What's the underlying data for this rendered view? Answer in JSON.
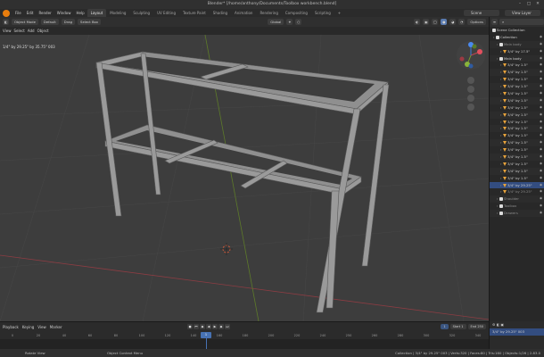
{
  "window": {
    "title": "Blender* [/home/anthony/Documents/Toolbox workbench.blend]"
  },
  "menu": {
    "items": [
      "File",
      "Edit",
      "Render",
      "Window",
      "Help"
    ]
  },
  "workspaces": [
    "Layout",
    "Modeling",
    "Sculpting",
    "UV Editing",
    "Texture Paint",
    "Shading",
    "Animation",
    "Rendering",
    "Compositing",
    "Scripting",
    "+"
  ],
  "scene": {
    "label": "Scene",
    "view_layer": "View Layer"
  },
  "viewport_header": {
    "mode": "Object Mode",
    "orientation": "Default",
    "drag": "Drag",
    "select": "Select Box",
    "view": "View",
    "select_menu": "Select",
    "add": "Add",
    "object": "Object",
    "transform": "Global",
    "options": "Options"
  },
  "viewport": {
    "info_line": "1/4\" by 29.25\" by 35.75\" 003"
  },
  "outliner": {
    "title": "Scene Collection",
    "rows": [
      {
        "label": "Collection",
        "kind": "collection",
        "indent": 1,
        "dim": false,
        "sel": false
      },
      {
        "label": "Main body",
        "kind": "collection",
        "indent": 2,
        "dim": true,
        "sel": false
      },
      {
        "label": "3/4\" by 17.5\"",
        "kind": "mesh",
        "indent": 3,
        "dim": false,
        "sel": false
      },
      {
        "label": "Main body",
        "kind": "collection",
        "indent": 2,
        "dim": false,
        "sel": false
      },
      {
        "label": "3/4\" by 1.5\"",
        "kind": "mesh",
        "indent": 3,
        "dim": false,
        "sel": false
      },
      {
        "label": "3/4\" by 1.5\"",
        "kind": "mesh",
        "indent": 3,
        "dim": false,
        "sel": false
      },
      {
        "label": "3/4\" by 1.5\"",
        "kind": "mesh",
        "indent": 3,
        "dim": false,
        "sel": false
      },
      {
        "label": "3/4\" by 1.5\"",
        "kind": "mesh",
        "indent": 3,
        "dim": false,
        "sel": false
      },
      {
        "label": "3/4\" by 1.5\"",
        "kind": "mesh",
        "indent": 3,
        "dim": false,
        "sel": false
      },
      {
        "label": "3/4\" by 1.5\"",
        "kind": "mesh",
        "indent": 3,
        "dim": false,
        "sel": false
      },
      {
        "label": "3/4\" by 1.5\"",
        "kind": "mesh",
        "indent": 3,
        "dim": false,
        "sel": false
      },
      {
        "label": "3/4\" by 1.5\"",
        "kind": "mesh",
        "indent": 3,
        "dim": false,
        "sel": false
      },
      {
        "label": "3/4\" by 1.5\"",
        "kind": "mesh",
        "indent": 3,
        "dim": false,
        "sel": false
      },
      {
        "label": "3/4\" by 1.5\"",
        "kind": "mesh",
        "indent": 3,
        "dim": false,
        "sel": false
      },
      {
        "label": "3/4\" by 1.5\"",
        "kind": "mesh",
        "indent": 3,
        "dim": false,
        "sel": false
      },
      {
        "label": "3/4\" by 1.5\"",
        "kind": "mesh",
        "indent": 3,
        "dim": false,
        "sel": false
      },
      {
        "label": "3/4\" by 1.5\"",
        "kind": "mesh",
        "indent": 3,
        "dim": false,
        "sel": false
      },
      {
        "label": "3/4\" by 1.5\"",
        "kind": "mesh",
        "indent": 3,
        "dim": false,
        "sel": false
      },
      {
        "label": "3/4\" by 1.5\"",
        "kind": "mesh",
        "indent": 3,
        "dim": false,
        "sel": false
      },
      {
        "label": "3/4\" by 1.5\"",
        "kind": "mesh",
        "indent": 3,
        "dim": false,
        "sel": false
      },
      {
        "label": "3/4\" by 1.5\"",
        "kind": "mesh",
        "indent": 3,
        "dim": false,
        "sel": false
      },
      {
        "label": "3/4\" by 29.25\"",
        "kind": "mesh",
        "indent": 3,
        "dim": false,
        "sel": true
      },
      {
        "label": "3/4\" by 29.25\"",
        "kind": "mesh",
        "indent": 3,
        "dim": true,
        "sel": false
      },
      {
        "label": "Shoulder",
        "kind": "collection",
        "indent": 2,
        "dim": true,
        "sel": false
      },
      {
        "label": "Toolbox",
        "kind": "collection",
        "indent": 2,
        "dim": true,
        "sel": false
      },
      {
        "label": "Drawers",
        "kind": "collection",
        "indent": 2,
        "dim": true,
        "sel": false
      }
    ]
  },
  "timeline": {
    "playback": "Playback",
    "keying": "Keying",
    "view": "View",
    "marker": "Marker",
    "current_frame": "1",
    "start_label": "Start",
    "start": "1",
    "end_label": "End",
    "end": "250",
    "ruler": [
      "0",
      "20",
      "40",
      "60",
      "80",
      "100",
      "120",
      "140",
      "160",
      "180",
      "200",
      "220",
      "240",
      "250",
      "260",
      "280",
      "300",
      "320",
      "340"
    ]
  },
  "properties": {
    "selected": "3/4\" by 29.25\" 003"
  },
  "statusbar": {
    "left1": "Rotate View",
    "left2": "Object Context Menu",
    "right": "Collection | 3/4\" by 29.25\" 003 | Verts:320 | Faces:80 | Tris:160 | Objects:1/26 | 2.83.0"
  },
  "colors": {
    "accent": "#4772b3",
    "viewport_bg": "#3d3d3d",
    "object_color": "#9a9a9a",
    "selection": "#334d80",
    "axis_x": "#c4424d",
    "axis_y": "#7a9c2d"
  },
  "icons": [
    "blender-logo-icon",
    "mesh-icon",
    "collection-icon",
    "eye-icon",
    "camera-icon",
    "play-icon",
    "gizmo-icon",
    "3d-cursor-icon"
  ]
}
